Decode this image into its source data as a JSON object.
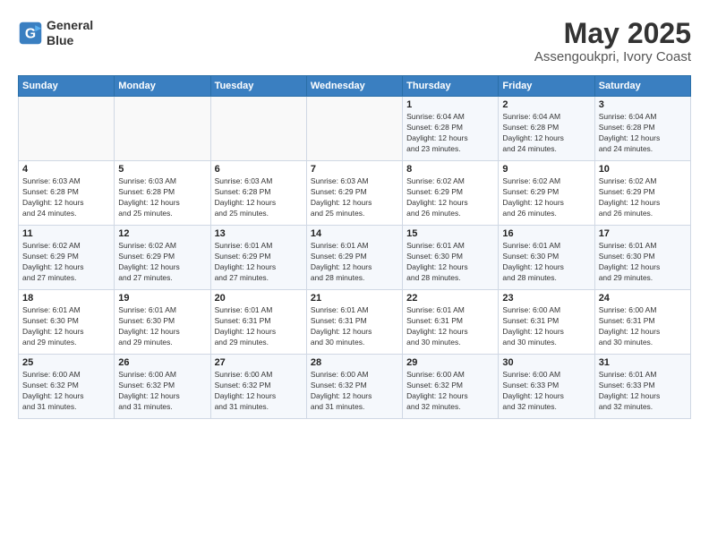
{
  "logo": {
    "line1": "General",
    "line2": "Blue"
  },
  "title": "May 2025",
  "subtitle": "Assengoukpri, Ivory Coast",
  "days_of_week": [
    "Sunday",
    "Monday",
    "Tuesday",
    "Wednesday",
    "Thursday",
    "Friday",
    "Saturday"
  ],
  "weeks": [
    [
      {
        "day": "",
        "info": ""
      },
      {
        "day": "",
        "info": ""
      },
      {
        "day": "",
        "info": ""
      },
      {
        "day": "",
        "info": ""
      },
      {
        "day": "1",
        "info": "Sunrise: 6:04 AM\nSunset: 6:28 PM\nDaylight: 12 hours\nand 23 minutes."
      },
      {
        "day": "2",
        "info": "Sunrise: 6:04 AM\nSunset: 6:28 PM\nDaylight: 12 hours\nand 24 minutes."
      },
      {
        "day": "3",
        "info": "Sunrise: 6:04 AM\nSunset: 6:28 PM\nDaylight: 12 hours\nand 24 minutes."
      }
    ],
    [
      {
        "day": "4",
        "info": "Sunrise: 6:03 AM\nSunset: 6:28 PM\nDaylight: 12 hours\nand 24 minutes."
      },
      {
        "day": "5",
        "info": "Sunrise: 6:03 AM\nSunset: 6:28 PM\nDaylight: 12 hours\nand 25 minutes."
      },
      {
        "day": "6",
        "info": "Sunrise: 6:03 AM\nSunset: 6:28 PM\nDaylight: 12 hours\nand 25 minutes."
      },
      {
        "day": "7",
        "info": "Sunrise: 6:03 AM\nSunset: 6:29 PM\nDaylight: 12 hours\nand 25 minutes."
      },
      {
        "day": "8",
        "info": "Sunrise: 6:02 AM\nSunset: 6:29 PM\nDaylight: 12 hours\nand 26 minutes."
      },
      {
        "day": "9",
        "info": "Sunrise: 6:02 AM\nSunset: 6:29 PM\nDaylight: 12 hours\nand 26 minutes."
      },
      {
        "day": "10",
        "info": "Sunrise: 6:02 AM\nSunset: 6:29 PM\nDaylight: 12 hours\nand 26 minutes."
      }
    ],
    [
      {
        "day": "11",
        "info": "Sunrise: 6:02 AM\nSunset: 6:29 PM\nDaylight: 12 hours\nand 27 minutes."
      },
      {
        "day": "12",
        "info": "Sunrise: 6:02 AM\nSunset: 6:29 PM\nDaylight: 12 hours\nand 27 minutes."
      },
      {
        "day": "13",
        "info": "Sunrise: 6:01 AM\nSunset: 6:29 PM\nDaylight: 12 hours\nand 27 minutes."
      },
      {
        "day": "14",
        "info": "Sunrise: 6:01 AM\nSunset: 6:29 PM\nDaylight: 12 hours\nand 28 minutes."
      },
      {
        "day": "15",
        "info": "Sunrise: 6:01 AM\nSunset: 6:30 PM\nDaylight: 12 hours\nand 28 minutes."
      },
      {
        "day": "16",
        "info": "Sunrise: 6:01 AM\nSunset: 6:30 PM\nDaylight: 12 hours\nand 28 minutes."
      },
      {
        "day": "17",
        "info": "Sunrise: 6:01 AM\nSunset: 6:30 PM\nDaylight: 12 hours\nand 29 minutes."
      }
    ],
    [
      {
        "day": "18",
        "info": "Sunrise: 6:01 AM\nSunset: 6:30 PM\nDaylight: 12 hours\nand 29 minutes."
      },
      {
        "day": "19",
        "info": "Sunrise: 6:01 AM\nSunset: 6:30 PM\nDaylight: 12 hours\nand 29 minutes."
      },
      {
        "day": "20",
        "info": "Sunrise: 6:01 AM\nSunset: 6:31 PM\nDaylight: 12 hours\nand 29 minutes."
      },
      {
        "day": "21",
        "info": "Sunrise: 6:01 AM\nSunset: 6:31 PM\nDaylight: 12 hours\nand 30 minutes."
      },
      {
        "day": "22",
        "info": "Sunrise: 6:01 AM\nSunset: 6:31 PM\nDaylight: 12 hours\nand 30 minutes."
      },
      {
        "day": "23",
        "info": "Sunrise: 6:00 AM\nSunset: 6:31 PM\nDaylight: 12 hours\nand 30 minutes."
      },
      {
        "day": "24",
        "info": "Sunrise: 6:00 AM\nSunset: 6:31 PM\nDaylight: 12 hours\nand 30 minutes."
      }
    ],
    [
      {
        "day": "25",
        "info": "Sunrise: 6:00 AM\nSunset: 6:32 PM\nDaylight: 12 hours\nand 31 minutes."
      },
      {
        "day": "26",
        "info": "Sunrise: 6:00 AM\nSunset: 6:32 PM\nDaylight: 12 hours\nand 31 minutes."
      },
      {
        "day": "27",
        "info": "Sunrise: 6:00 AM\nSunset: 6:32 PM\nDaylight: 12 hours\nand 31 minutes."
      },
      {
        "day": "28",
        "info": "Sunrise: 6:00 AM\nSunset: 6:32 PM\nDaylight: 12 hours\nand 31 minutes."
      },
      {
        "day": "29",
        "info": "Sunrise: 6:00 AM\nSunset: 6:32 PM\nDaylight: 12 hours\nand 32 minutes."
      },
      {
        "day": "30",
        "info": "Sunrise: 6:00 AM\nSunset: 6:33 PM\nDaylight: 12 hours\nand 32 minutes."
      },
      {
        "day": "31",
        "info": "Sunrise: 6:01 AM\nSunset: 6:33 PM\nDaylight: 12 hours\nand 32 minutes."
      }
    ]
  ]
}
